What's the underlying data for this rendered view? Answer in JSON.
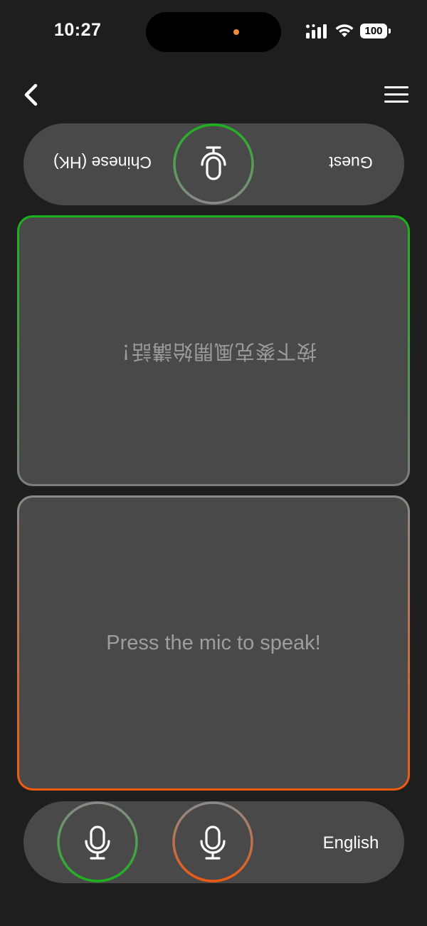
{
  "status_bar": {
    "time": "10:27",
    "battery": "100",
    "icons": [
      "signal-icon",
      "wifi-icon",
      "battery-icon"
    ]
  },
  "header": {
    "back_icon": "chevron-left-icon",
    "menu_icon": "hamburger-menu-icon"
  },
  "guest_bar": {
    "label": "Guest",
    "language": "Chinese (HK)",
    "mic_icon": "microphone-icon",
    "orientation": "rotated 180deg"
  },
  "guest_panel": {
    "prompt": "按下麥克風開始講話！"
  },
  "host_panel": {
    "prompt": "Press the mic to speak!"
  },
  "host_bar": {
    "language": "English",
    "mic_left_icon": "microphone-icon",
    "mic_right_icon": "microphone-icon"
  },
  "colors": {
    "background": "#1e1e1e",
    "surface": "#494949",
    "accent_green": "#1cb21c",
    "accent_orange": "#f05a10",
    "placeholder_text": "#9b9b9b"
  }
}
